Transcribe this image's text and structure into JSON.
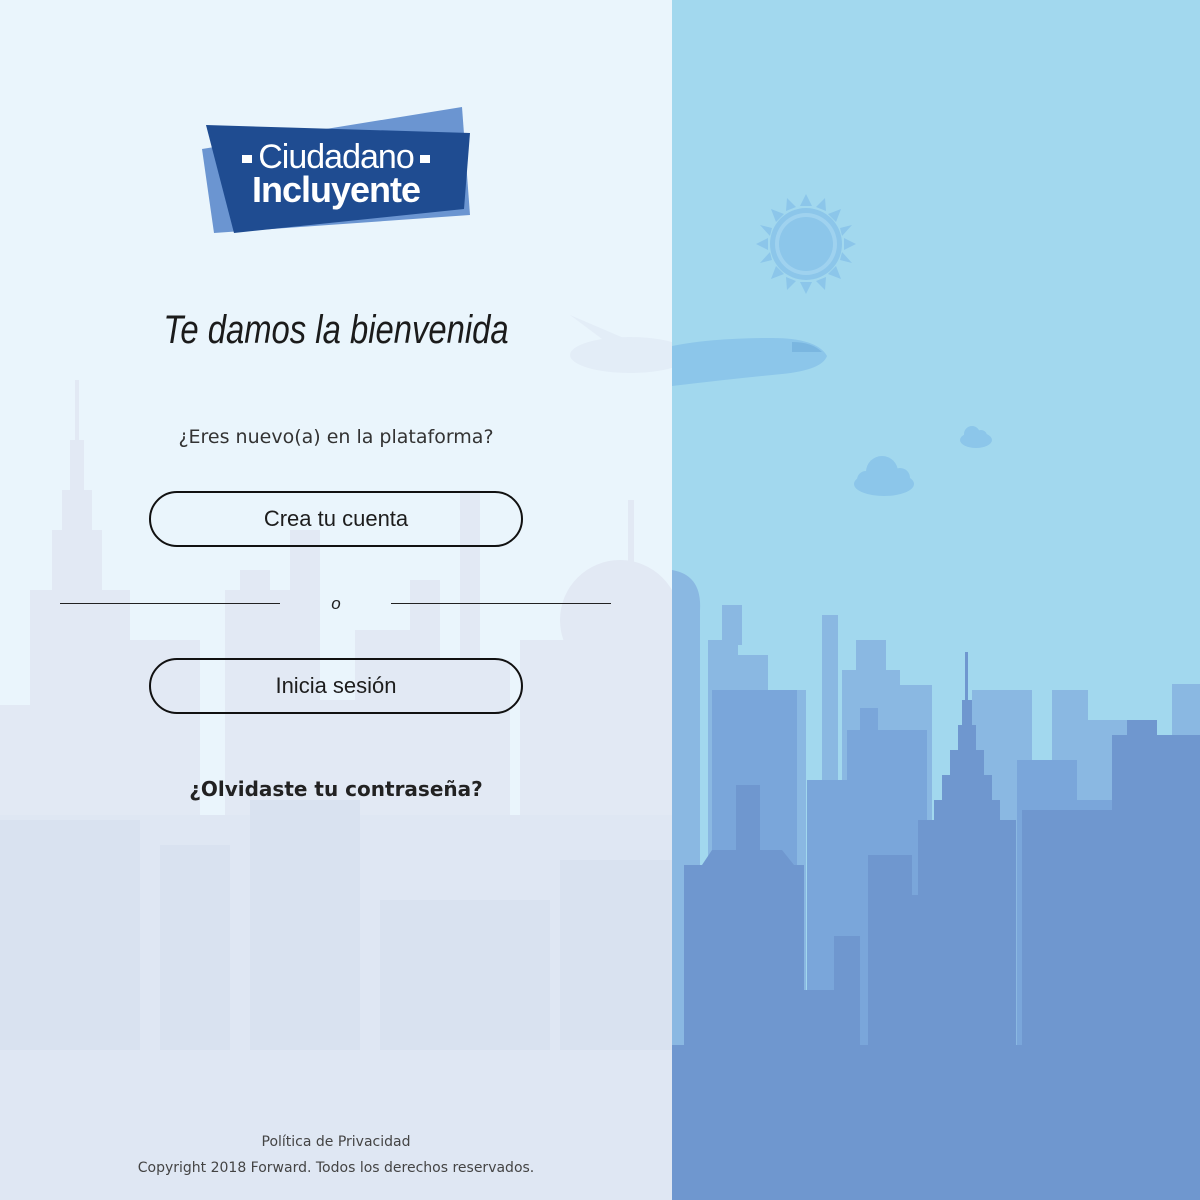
{
  "logo": {
    "line1": "Ciudadano",
    "line2": "Incluyente"
  },
  "welcome": {
    "title": "Te damos la bienvenida",
    "question": "¿Eres nuevo(a) en la plataforma?"
  },
  "actions": {
    "create_account_label": "Crea tu cuenta",
    "divider_label": "o",
    "login_label": "Inicia sesión",
    "forgot_password_label": "¿Olvidaste tu contraseña?"
  },
  "footer": {
    "privacy_label": "Política de Privacidad",
    "copyright": "Copyright 2018 Forward. Todos los derechos reservados."
  },
  "illustration": {
    "icons": [
      "sun-icon",
      "airplane-icon",
      "cloud-icon",
      "city-skyline"
    ]
  },
  "colors": {
    "brand_dark_blue": "#1f4c91",
    "brand_light_blue": "#6b95d1",
    "sky": "#a2d8ee",
    "left_panel_background": "#eaf5fc",
    "buildings_front": "#6f97cf",
    "buildings_back": "#8ab8e2"
  }
}
